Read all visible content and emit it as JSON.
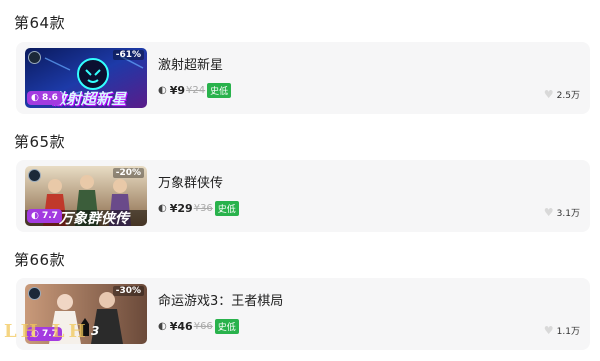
{
  "sections": [
    {
      "title": "第64款",
      "game": {
        "name": "激射超新星",
        "price": "¥9",
        "original": "¥24",
        "tag": "史低",
        "discount": "-61%",
        "score": "8.6",
        "likes": "2.5万",
        "cover_text": "激射超新星"
      }
    },
    {
      "title": "第65款",
      "game": {
        "name": "万象群侠传",
        "price": "¥29",
        "original": "¥36",
        "tag": "史低",
        "discount": "-20%",
        "score": "7.7",
        "likes": "3.1万",
        "cover_text": "万象群侠传"
      }
    },
    {
      "title": "第66款",
      "game": {
        "name": "命运游戏3：王者棋局",
        "price": "¥46",
        "original": "¥66",
        "tag": "史低",
        "discount": "-30%",
        "score": "7.7",
        "likes": "1.1万",
        "cover_text": "3"
      }
    }
  ],
  "icons": {
    "platform": "steam-icon",
    "like": "heart-icon"
  },
  "colors": {
    "low_tag": "#29b24c",
    "score_badge": "#a33be0",
    "card_bg": "#f6f6f7"
  }
}
